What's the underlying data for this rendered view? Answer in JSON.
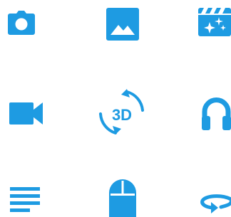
{
  "theme": {
    "icon_color": "#1E9BE2",
    "background": "#FFFFFF"
  },
  "icons": [
    {
      "name": "camera-icon"
    },
    {
      "name": "image-icon"
    },
    {
      "name": "movie-magic-icon"
    },
    {
      "name": "videocam-icon"
    },
    {
      "name": "rotate-3d-icon",
      "text": "3D"
    },
    {
      "name": "headphones-icon"
    },
    {
      "name": "subject-text-icon"
    },
    {
      "name": "mouse-icon"
    },
    {
      "name": "rotate-360-icon"
    }
  ]
}
